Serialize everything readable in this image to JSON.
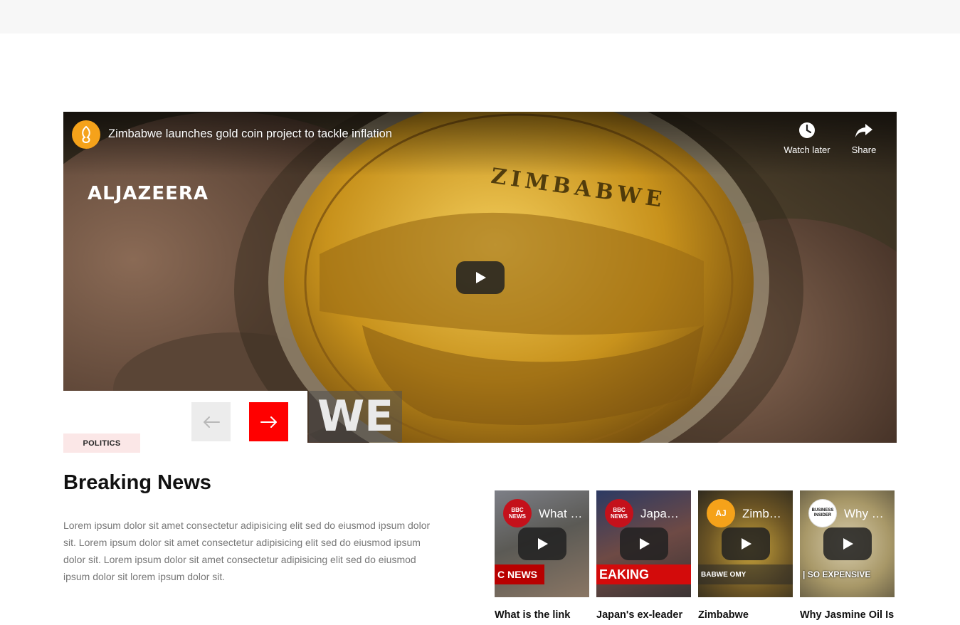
{
  "main_video": {
    "title": "Zimbabwe launches gold coin project to tackle inflation",
    "channel_logo_text": "ALJAZEERA",
    "coin_text": "ZIMBABWE",
    "lower_third_text": "WE",
    "watch_later_label": "Watch later",
    "share_label": "Share"
  },
  "slider_nav": {
    "prev_icon": "arrow-left-icon",
    "next_icon": "arrow-right-icon"
  },
  "article": {
    "category": "POLITICS",
    "headline": "Breaking News",
    "body": "Lorem ipsum dolor sit amet consectetur adipisicing elit sed do eiusmod ipsum dolor sit. Lorem ipsum dolor sit amet consectetur adipisicing elit sed do eiusmod ipsum dolor sit. Lorem ipsum dolor sit amet consectetur adipisicing elit sed do eiusmod ipsum dolor sit lorem ipsum dolor sit."
  },
  "thumbnails": [
    {
      "badge_text": "BBC NEWS",
      "title": "What …",
      "strip_text": "C NEWS",
      "caption": "What is the link",
      "badge_color": "#c4111b"
    },
    {
      "badge_text": "BBC NEWS",
      "title": "Japa…",
      "strip_text": "EAKING",
      "caption": "Japan's ex-leader",
      "badge_color": "#c4111b"
    },
    {
      "badge_text": "AJ",
      "title": "Zimb…",
      "strip_text": "BABWE OMY",
      "caption": "Zimbabwe",
      "badge_color": "#f5a21a"
    },
    {
      "badge_text": "BUSINESS INSIDER",
      "title": "Why …",
      "strip_text": "| SO EXPENSIVE",
      "caption": "Why Jasmine Oil Is",
      "badge_color": "#ffffff"
    }
  ],
  "colors": {
    "accent_red": "#ff0000",
    "category_bg": "#fbe7e7",
    "prev_bg": "#ececec"
  }
}
